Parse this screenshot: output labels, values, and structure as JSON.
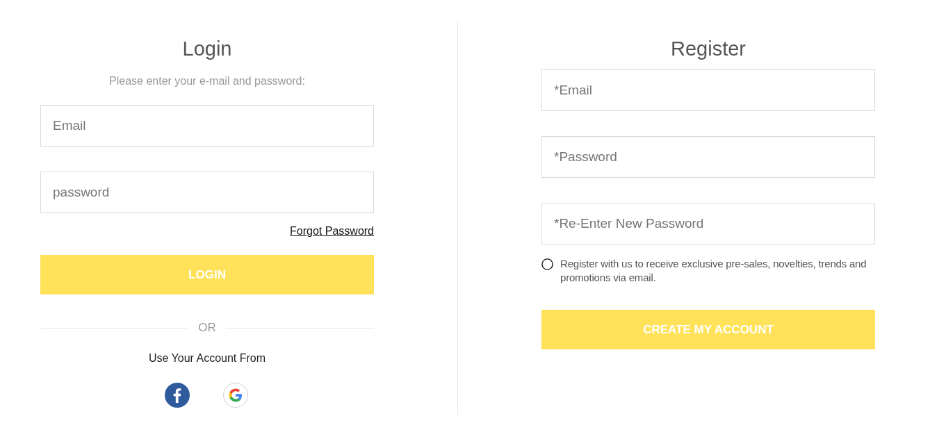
{
  "login": {
    "title": "Login",
    "subtitle": "Please enter your e-mail and password:",
    "fields": [
      {
        "placeholder": "Email"
      },
      {
        "placeholder": "password"
      }
    ],
    "forgot_link": "Forgot Password",
    "button": "LOGIN",
    "divider_text": "OR",
    "social_prompt": "Use Your Account From",
    "social": [
      {
        "kind": "facebook"
      },
      {
        "kind": "google"
      }
    ]
  },
  "register": {
    "title": "Register",
    "fields": [
      {
        "placeholder": "*Email"
      },
      {
        "placeholder": "*Password"
      },
      {
        "placeholder": "*Re-Enter New Password"
      }
    ],
    "consent": {
      "label": "Register with us to receive exclusive pre-sales, novelties, trends and promotions via email.",
      "checked": false
    },
    "button": "CREATE MY ACCOUNT"
  }
}
